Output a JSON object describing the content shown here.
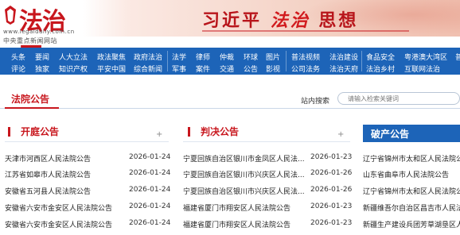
{
  "header": {
    "logo_title": "法治网",
    "logo_url": "www.legaldaily.com.cn",
    "logo_slogan": "中央重点新闻网站",
    "banner_text_a": "习近平",
    "banner_text_b": "法治",
    "banner_text_c": "思想"
  },
  "nav": {
    "groups": [
      {
        "row1": [
          "头条",
          "要闻",
          "人大立法",
          "政法聚焦",
          "政府法治"
        ],
        "row2": [
          "评论",
          "独家",
          "知识产权",
          "平安中国",
          "综合新闻"
        ]
      },
      {
        "row1": [
          "法学",
          "律师",
          "仲裁",
          "环球",
          "图片"
        ],
        "row2": [
          "军事",
          "案件",
          "交通",
          "公告",
          "影视"
        ]
      },
      {
        "row1": [
          "普法视频",
          "法治建设"
        ],
        "row2": [
          "公司法务",
          "法治天府"
        ]
      },
      {
        "row1": [
          "食品安全",
          "粤港澳大湾区",
          "普"
        ],
        "row2": [
          "法治乡村",
          "互联网法治"
        ]
      }
    ]
  },
  "section": {
    "title": "法院公告",
    "search_label": "站内搜索",
    "search_placeholder": "请输入检索关键词"
  },
  "columns": [
    {
      "title": "开庭公告",
      "plus": "+",
      "rows": [
        {
          "title": "天津市河西区人民法院公告",
          "date": "2026-01-24"
        },
        {
          "title": "江苏省如皋市人民法院公告",
          "date": "2026-01-24"
        },
        {
          "title": "安徽省五河县人民法院公告",
          "date": "2026-01-24"
        },
        {
          "title": "安徽省六安市金安区人民法院公告",
          "date": "2026-01-24"
        },
        {
          "title": "安徽省六安市金安区人民法院公告",
          "date": "2026-01-24"
        }
      ]
    },
    {
      "title": "判决公告",
      "plus": "+",
      "rows": [
        {
          "title": "宁夏回族自治区银川市金凤区人民法...",
          "date": "2026-01-23"
        },
        {
          "title": "宁夏回族自治区银川市兴庆区人民法...",
          "date": "2026-01-26"
        },
        {
          "title": "宁夏回族自治区银川市兴庆区人民法...",
          "date": "2026-01-26"
        },
        {
          "title": "福建省厦门市翔安区人民法院公告",
          "date": "2026-01-23"
        },
        {
          "title": "福建省厦门市翔安区人民法院公告",
          "date": "2026-01-23"
        }
      ]
    },
    {
      "title": "破产公告",
      "rows": [
        {
          "title": "辽宁省锦州市太和区人民法院公..."
        },
        {
          "title": "山东省曲阜市人民法院公告"
        },
        {
          "title": "辽宁省锦州市太和区人民法院公..."
        },
        {
          "title": "新疆维吾尔自治区昌吉市人民法..."
        },
        {
          "title": "新疆生产建设兵团芳草湖垦区人..."
        }
      ]
    }
  ],
  "colors": {
    "brand_red": "#c8161d",
    "nav_blue": "#1d64b8"
  }
}
